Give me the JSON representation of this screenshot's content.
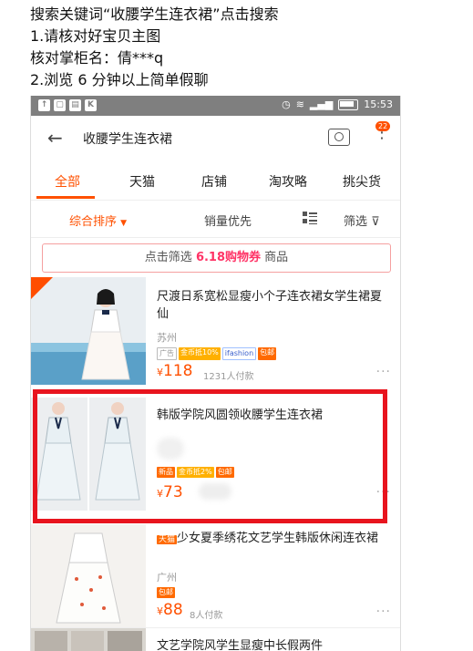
{
  "instructions": [
    "搜索关键词“收腰学生连衣裙”点击搜索",
    "1.请核对好宝贝主图",
    "核对掌柜名：倩***q",
    "2.浏览 6 分钟以上简单假聊"
  ],
  "statusbar": {
    "time": "15:53"
  },
  "search": {
    "query": "收腰学生连衣裙",
    "badge": "22"
  },
  "tabs": [
    "全部",
    "天猫",
    "店铺",
    "淘攻略",
    "挑尖货"
  ],
  "sort": {
    "comprehensive": "综合排序",
    "sales": "销量优先",
    "filter": "筛选"
  },
  "coupon": {
    "prefix": "点击筛选",
    "highlight": "6.18购物券",
    "suffix": "商品"
  },
  "products": [
    {
      "title": "尺渡日系宽松显瘦小个子连衣裙女学生裙夏仙",
      "location": "苏州",
      "tags": [
        "广告",
        "金币抵10%",
        "ifashion",
        "包邮"
      ],
      "price_currency": "¥",
      "price": "118",
      "sold": "1231人付款"
    },
    {
      "title": "韩版学院风圆领收腰学生连衣裙",
      "tags": [
        "新品",
        "金币抵2%",
        "包邮"
      ],
      "price_currency": "¥",
      "price": "73"
    },
    {
      "title_tag": "天猫",
      "title": "少女夏季绣花文艺学生韩版休闲连衣裙",
      "location": "广州",
      "tags": [
        "包邮"
      ],
      "price_currency": "¥",
      "price": "88",
      "sold": "8人付款"
    },
    {
      "title": "文艺学院风学生显瘦中长假两件"
    }
  ],
  "colors": {
    "accent": "#ff5000",
    "highlight_box": "#e8141e"
  }
}
